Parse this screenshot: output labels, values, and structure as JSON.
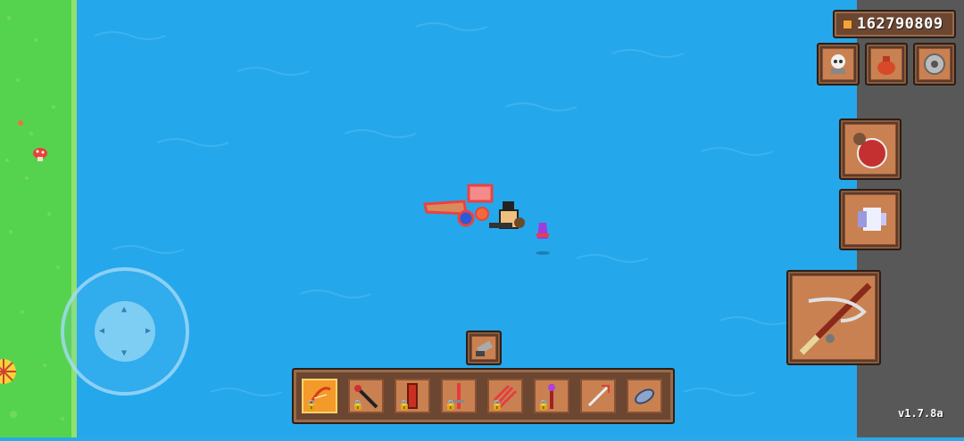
{
  "hud": {
    "coins": "162790809",
    "version": "v1.7.8a",
    "coin_color": "#f0a43a"
  },
  "top_buttons": [
    {
      "name": "skull-trophy-icon"
    },
    {
      "name": "loot-bag-icon"
    },
    {
      "name": "gear-icon"
    }
  ],
  "side_buttons": [
    {
      "name": "potion-icon"
    },
    {
      "name": "ghost-dash-icon"
    }
  ],
  "equipped": {
    "name": "fishing-rod-icon"
  },
  "extra_slot": {
    "name": "cannon-icon"
  },
  "hotbar": [
    {
      "name": "red-bow-icon",
      "active": true,
      "locked": true
    },
    {
      "name": "black-staff-icon",
      "active": false,
      "locked": true
    },
    {
      "name": "red-pillar-icon",
      "active": false,
      "locked": true
    },
    {
      "name": "red-sword-icon",
      "active": false,
      "locked": true
    },
    {
      "name": "red-claws-icon",
      "active": false,
      "locked": true
    },
    {
      "name": "red-spear-icon",
      "active": false,
      "locked": true
    },
    {
      "name": "fish-bone-icon",
      "active": false,
      "locked": false
    },
    {
      "name": "fish-icon",
      "active": false,
      "locked": false
    }
  ],
  "colors": {
    "water": "#25a7ec",
    "grass": "#56d34e",
    "frame": "#6b4631",
    "slot": "#c98152",
    "active_slot": "#f39a2a"
  }
}
